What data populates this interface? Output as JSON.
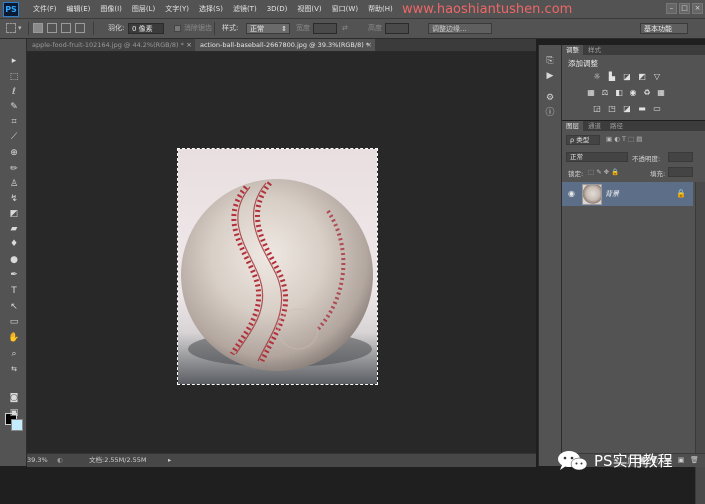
{
  "app": {
    "logo": "PS"
  },
  "menubar": {
    "items": [
      "文件(F)",
      "编辑(E)",
      "图像(I)",
      "图层(L)",
      "文字(Y)",
      "选择(S)",
      "滤镜(T)",
      "3D(D)",
      "视图(V)",
      "窗口(W)",
      "帮助(H)"
    ],
    "watermark": "www.haoshiantushen.com"
  },
  "options": {
    "feather_label": "羽化:",
    "feather_value": "0 像素",
    "antialias_label": "消除锯齿",
    "style_label": "样式:",
    "style_value": "正常",
    "width_label": "宽度",
    "height_label": "高度",
    "refine_edge": "调整边缘...",
    "workspace": "基本功能"
  },
  "tabs": [
    {
      "label": "apple-food-fruit-102164.jpg @ 44.2%(RGB/8) *",
      "active": false
    },
    {
      "label": "action-ball-baseball-2667800.jpg @ 39.3%(RGB/8) *",
      "active": true
    }
  ],
  "status": {
    "zoom": "39.3%",
    "doc_info": "文档:2.55M/2.55M"
  },
  "adjustments": {
    "tabs": [
      "调整",
      "样式"
    ],
    "title": "添加调整"
  },
  "layers": {
    "tabs": [
      "图层",
      "通道",
      "路径"
    ],
    "filter_kind": "ρ 类型",
    "blend_mode": "正常",
    "opacity_label": "不透明度:",
    "lock_label": "锁定:",
    "fill_label": "填充:",
    "layer_name": "背景"
  },
  "credit": {
    "text": "PS实用教程"
  },
  "colors": {
    "foreground": "#000000",
    "background": "#c4ecff",
    "layer_selected": "#5d6f88",
    "watermark": "#ff6a6a"
  }
}
